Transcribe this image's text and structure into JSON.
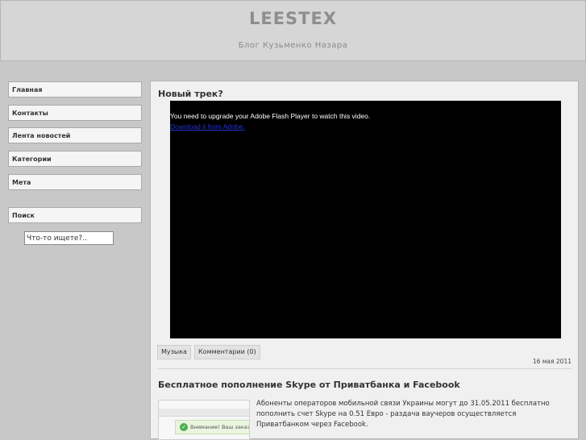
{
  "header": {
    "site_title": "LEESTEX",
    "site_description": "Блог Кузьменко Назара"
  },
  "sidebar": {
    "items": [
      {
        "label": "Главная"
      },
      {
        "label": "Контакты"
      },
      {
        "label": "Лента новостей"
      },
      {
        "label": "Категории"
      },
      {
        "label": "Мета"
      }
    ],
    "search": {
      "title": "Поиск",
      "input_value": "Что-то ищете?.."
    }
  },
  "posts": [
    {
      "title": "Новый трек?",
      "video": {
        "message": "You need to upgrade your Adobe Flash Player to watch this video.",
        "download_link": "Download it from Adobe."
      },
      "tags": [
        "Музыка",
        "Комментарии (0)"
      ],
      "date": "16 мая 2011"
    },
    {
      "title": "Бесплатное пополнение Skype от Приватбанка и Facebook",
      "thumbnail_text": "Внимание! Ваш заказ",
      "excerpt": "Абоненты операторов мобильной связи Украины могут до 31.05.2011 бесплатно пополнить счет Skype на 0.51 Евро - раздача ваучеров осуществляется Приватбанком через Facebook."
    }
  ],
  "colors": {
    "background": "#c8c8c8",
    "header_bg": "#d6d6d6",
    "content_bg": "#f0f0f0",
    "video_bg": "#000000",
    "link": "#2233cc"
  }
}
